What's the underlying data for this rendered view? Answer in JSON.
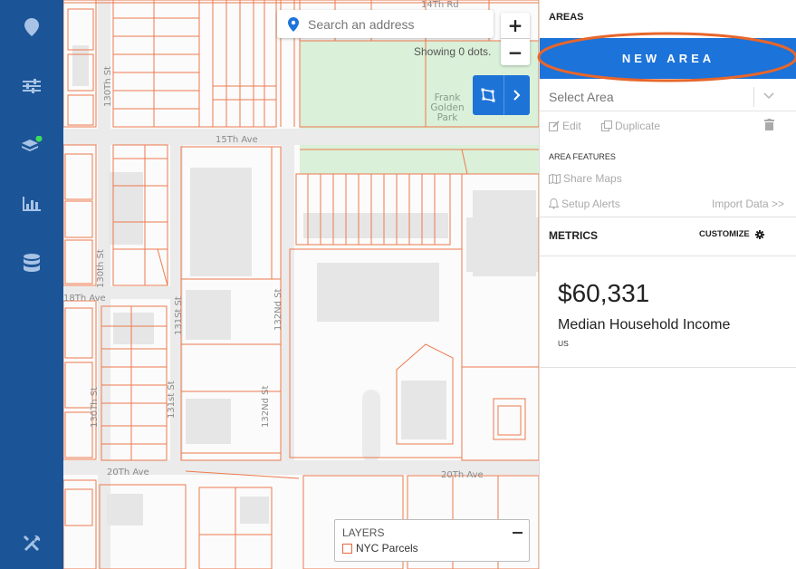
{
  "nav": {
    "items": [
      {
        "icon": "map-pin-icon"
      },
      {
        "icon": "sliders-icon"
      },
      {
        "icon": "layers-icon",
        "badge_color": "#3ddc5b"
      },
      {
        "icon": "bar-chart-icon"
      },
      {
        "icon": "database-icon"
      },
      {
        "icon": "tools-icon"
      }
    ],
    "background": "#1b5597"
  },
  "map": {
    "search": {
      "placeholder": "Search an address"
    },
    "zoom_in": "+",
    "zoom_out": "−",
    "status": "Showing 0 dots.",
    "street_labels": {
      "s130th_a": "130Th St",
      "s130th_b": "130th St",
      "s130th_c": "130Th St",
      "s15th": "15Th Ave",
      "s18th": "18Th Ave",
      "s131st_a": "131St St",
      "s131st_b": "131st St",
      "s132nd_a": "132Nd St",
      "s132nd_b": "132Nd St",
      "s20th_a": "20Th Ave",
      "s20th_b": "20Th Ave",
      "s14th": "14Th Rd"
    },
    "park_name": [
      "Frank",
      "Golden",
      "Park"
    ],
    "parcel_color": "#ee7a4c",
    "park_color": "#daf0d9",
    "layers": {
      "title": "LAYERS",
      "items": [
        "NYC Parcels"
      ]
    }
  },
  "panel": {
    "areas_header": "AREAS",
    "new_area_button": "NEW AREA",
    "select_area_placeholder": "Select Area",
    "edit": "Edit",
    "duplicate": "Duplicate",
    "area_features_label": "AREA FEATURES",
    "share_maps": "Share Maps",
    "setup_alerts": "Setup Alerts",
    "import_data": "Import Data >>",
    "metrics_label": "METRICS",
    "customize": "CUSTOMIZE",
    "metric": {
      "value": "$60,331",
      "label": "Median Household Income",
      "region": "US"
    },
    "accent_color": "#1c73d9",
    "highlight_color": "#e8662a"
  }
}
